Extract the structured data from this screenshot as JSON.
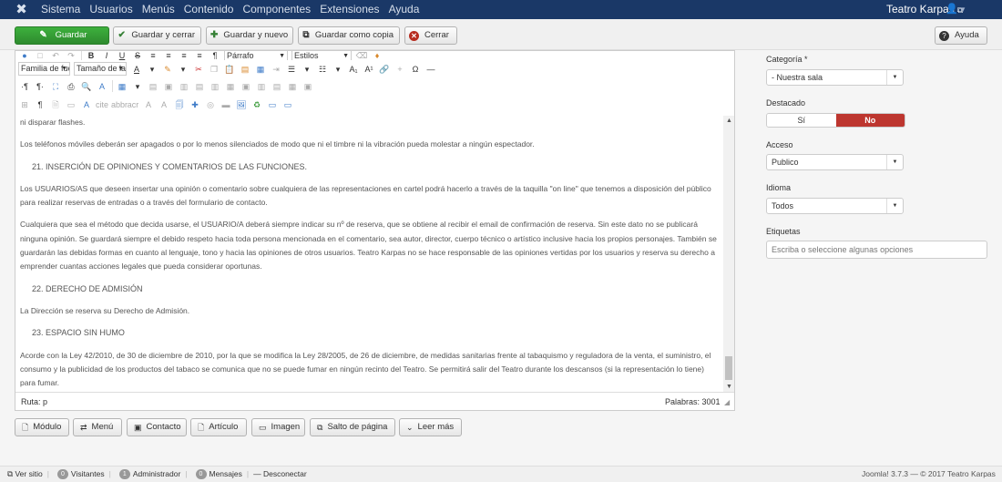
{
  "topbar": {
    "menu": [
      "Sistema",
      "Usuarios",
      "Menús",
      "Contenido",
      "Componentes",
      "Extensiones",
      "Ayuda"
    ],
    "site_name": "Teatro Karpas",
    "colors": {
      "bar": "#1a3867"
    }
  },
  "toolbar": {
    "save": "Guardar",
    "save_close": "Guardar y cerrar",
    "save_new": "Guardar y nuevo",
    "save_copy": "Guardar como copia",
    "close": "Cerrar",
    "help": "Ayuda"
  },
  "editor": {
    "font_family": "Familia de fue",
    "font_size": "Tamaño de la",
    "format": "Párrafo",
    "styles": "Estilos",
    "content": [
      {
        "type": "p",
        "text": "ni disparar flashes."
      },
      {
        "type": "p",
        "text": "Los teléfonos móviles deberán ser apagados o por lo menos silenciados de modo que ni el timbre ni la vibración pueda molestar a ningún espectador."
      },
      {
        "type": "h",
        "text": "21. INSERCIÓN DE OPINIONES Y COMENTARIOS DE LAS FUNCIONES."
      },
      {
        "type": "p",
        "text": "Los USUARIOS/AS que deseen insertar una opinión o comentario sobre cualquiera de las representaciones en cartel podrá hacerlo a través de la taquilla \"on line\" que tenemos a disposición del público para realizar reservas de entradas o a través del formulario de contacto."
      },
      {
        "type": "p",
        "text": "Cualquiera que sea el método que decida usarse, el USUARIO/A deberá siempre indicar su nº de reserva, que se obtiene al recibir el email de confirmación de reserva. Sin este dato no se publicará ninguna opinión. Se guardará siempre el debido respeto hacia toda persona mencionada en el comentario, sea autor, director, cuerpo técnico o artístico inclusive hacia los propios personajes. También se guardarán las debidas formas en cuanto al lenguaje, tono y hacia las opiniones de otros usuarios. Teatro Karpas no se hace responsable de las opiniones vertidas por los usuarios y reserva su derecho a emprender cuantas acciones legales que pueda considerar oportunas."
      },
      {
        "type": "h",
        "text": "22. DERECHO DE ADMISIÓN"
      },
      {
        "type": "p",
        "text": "La Dirección se reserva su Derecho de Admisión."
      },
      {
        "type": "h",
        "text": "23. ESPACIO SIN HUMO"
      },
      {
        "type": "p",
        "text": "Acorde con la Ley 42/2010, de 30 de diciembre de 2010, por la que se modifica la Ley 28/2005, de 26 de diciembre, de medidas sanitarias frente al tabaquismo y reguladora de la venta, el suministro, el consumo y la publicidad de los productos del tabaco se comunica que no se puede fumar en ningún recinto del Teatro.  Se permitirá salir del Teatro durante los descansos (si la representación lo tiene) para fumar."
      }
    ],
    "path_label": "Ruta: p",
    "word_count": "Palabras: 3001"
  },
  "insert_buttons": {
    "module": "Módulo",
    "menu": "Menú",
    "contact": "Contacto",
    "article": "Artículo",
    "image": "Imagen",
    "pagebreak": "Salto de página",
    "readmore": "Leer más"
  },
  "sidebar": {
    "category_label": "Categoría *",
    "category_value": "- Nuestra sala",
    "featured_label": "Destacado",
    "featured_yes": "Sí",
    "featured_no": "No",
    "featured_selected": "No",
    "access_label": "Acceso",
    "access_value": "Publico",
    "language_label": "Idioma",
    "language_value": "Todos",
    "tags_label": "Etiquetas",
    "tags_placeholder": "Escriba o seleccione algunas opciones"
  },
  "footer": {
    "view_site": "Ver sitio",
    "visitors_count": "0",
    "visitors": "Visitantes",
    "admin_count": "1",
    "admin": "Administrador",
    "messages_count": "0",
    "messages": "Mensajes",
    "logout": "Desconectar",
    "version": "Joomla! 3.7.3 — © 2017 Teatro Karpas"
  }
}
